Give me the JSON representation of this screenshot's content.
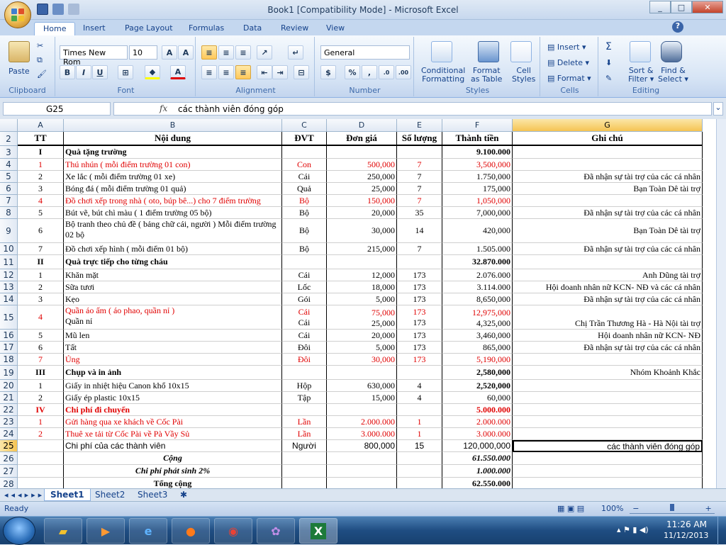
{
  "window": {
    "title": "Book1  [Compatibility Mode] - Microsoft Excel"
  },
  "tabs": [
    "Home",
    "Insert",
    "Page Layout",
    "Formulas",
    "Data",
    "Review",
    "View"
  ],
  "ribbon": {
    "clipboard": {
      "paste": "Paste",
      "label": "Clipboard"
    },
    "font": {
      "name": "Times New Rom",
      "size": "10",
      "label": "Font"
    },
    "alignment": {
      "label": "Alignment"
    },
    "number": {
      "format": "General",
      "label": "Number"
    },
    "styles": {
      "cond": "Conditional",
      "cond2": "Formatting",
      "fmt": "Format",
      "fmt2": "as Table",
      "cell": "Cell",
      "cell2": "Styles",
      "label": "Styles"
    },
    "cells": {
      "insert": "Insert",
      "delete": "Delete",
      "format": "Format",
      "label": "Cells"
    },
    "editing": {
      "sort": "Sort &",
      "sort2": "Filter",
      "find": "Find &",
      "find2": "Select",
      "label": "Editing"
    }
  },
  "formula_bar": {
    "name_box": "G25",
    "fx": "fx",
    "content": "các  thành viên đóng góp"
  },
  "columns": [
    "A",
    "B",
    "C",
    "D",
    "E",
    "F",
    "G"
  ],
  "rows": [
    {
      "n": "2",
      "cells": [
        "TT",
        "Nội dung",
        "ĐVT",
        "Đơn giá",
        "Số lượng",
        "Thành tiền",
        "Ghi chú"
      ]
    },
    {
      "n": "3",
      "cells": [
        "I",
        "Quà tặng trường",
        "",
        "",
        "",
        "9.100.000",
        ""
      ]
    },
    {
      "n": "4",
      "cells": [
        "1",
        "Thú nhún ( mỗi điểm trường 01 con)",
        "Con",
        "500,000",
        "7",
        "3,500,000",
        ""
      ]
    },
    {
      "n": "5",
      "cells": [
        "2",
        "Xe lắc ( mỗi điểm trường 01 xe)",
        "Cái",
        "250,000",
        "7",
        "1.750,000",
        "Đã nhận sự tài  trợ của các cá nhân"
      ]
    },
    {
      "n": "6",
      "cells": [
        "3",
        "Bóng đá ( mỗi điểm trường 01 quả)",
        "Quả",
        "25,000",
        "7",
        "175,000",
        "Bạn Toàn Dê tài trợ"
      ]
    },
    {
      "n": "7",
      "cells": [
        "4",
        "Đồ chơi xếp trong nhà ( oto, búp bê...) cho 7 điểm trường",
        "Bộ",
        "150,000",
        "7",
        "1,050,000",
        ""
      ]
    },
    {
      "n": "8",
      "cells": [
        "5",
        "Bút vẽ, bút chì màu ( 1 điểm trường 05 bộ)",
        "Bộ",
        "20,000",
        "35",
        "7,000,000",
        "Đã nhận sự tài  trợ của các cá nhân"
      ]
    },
    {
      "n": "9",
      "cells": [
        "6",
        "Bộ tranh theo chủ đề ( bảng chữ cái, người ) Mỗi điểm trường 02 bộ",
        "Bộ",
        "30,000",
        "14",
        "420,000",
        "Bạn Toàn Dê tài trợ"
      ]
    },
    {
      "n": "10",
      "cells": [
        "7",
        "Đồ chơi xếp hình ( mỗi điểm 01 bộ)",
        "Bộ",
        "215,000",
        "7",
        "1.505.000",
        "Đã nhận sự tài  trợ của các cá nhân"
      ]
    },
    {
      "n": "11",
      "cells": [
        "II",
        "Quà trực tiếp cho từng cháu",
        "",
        "",
        "",
        "32.870.000",
        ""
      ]
    },
    {
      "n": "12",
      "cells": [
        "1",
        "Khăn mặt",
        "Cái",
        "12,000",
        "173",
        "2.076.000",
        "Anh Dũng tài trợ"
      ]
    },
    {
      "n": "13",
      "cells": [
        "2",
        "Sữa tươi",
        "Lốc",
        "18,000",
        "173",
        "3.114.000",
        "Hội doanh nhân nữ KCN- NĐ và các cá nhân"
      ]
    },
    {
      "n": "14",
      "cells": [
        "3",
        "Kẹo",
        "Gói",
        "5,000",
        "173",
        "8,650,000",
        "Đã nhận sự tài  trợ của các cá nhân"
      ]
    },
    {
      "n": "15",
      "cells": [
        "4",
        "Quần áo ấm ( áo phao, quần nỉ )",
        "Cái",
        "75,000",
        "173",
        "12,975,000",
        ""
      ],
      "sub": [
        "",
        "Quần nỉ",
        "Cái",
        "25,000",
        "173",
        "4,325,000",
        "Chị Trần Thương Hà - Hà Nội tài trợ"
      ]
    },
    {
      "n": "16",
      "cells": [
        "5",
        "Mũ len",
        "Cái",
        "20,000",
        "173",
        "3,460,000",
        "Hội doanh nhân nữ KCN- NĐ"
      ]
    },
    {
      "n": "17",
      "cells": [
        "6",
        "Tất",
        "Đôi",
        "5,000",
        "173",
        "865,000",
        "Đã nhận sự tài  trợ của các cá nhân"
      ]
    },
    {
      "n": "18",
      "cells": [
        "7",
        "Ủng",
        "Đôi",
        "30,000",
        "173",
        "5,190,000",
        ""
      ]
    },
    {
      "n": "19",
      "cells": [
        "III",
        "Chụp và in ảnh",
        "",
        "",
        "",
        "2,580,000",
        "Nhóm Khoảnh Khắc"
      ]
    },
    {
      "n": "20",
      "cells": [
        "1",
        "Giấy in nhiệt hiệu Canon khổ 10x15",
        "Hộp",
        "630,000",
        "4",
        "2,520,000",
        ""
      ]
    },
    {
      "n": "21",
      "cells": [
        "2",
        "Giấy ép plastic 10x15",
        "Tập",
        "15,000",
        "4",
        "60,000",
        ""
      ]
    },
    {
      "n": "22",
      "cells": [
        "IV",
        "Chi phí đi chuyển",
        "",
        "",
        "",
        "5.000.000",
        ""
      ]
    },
    {
      "n": "23",
      "cells": [
        "1",
        "Gửi hàng qua xe khách về Cốc Pài",
        "Lần",
        "2.000.000",
        "1",
        "2.000.000",
        ""
      ]
    },
    {
      "n": "24",
      "cells": [
        "2",
        "Thuê xe tải từ Cốc Pài về Pà Vầy Sủ",
        "Lần",
        "3.000.000",
        "1",
        "3.000.000",
        ""
      ]
    },
    {
      "n": "25",
      "cells": [
        "",
        "Chi phí của các thành viên",
        "Người",
        "800,000",
        "15",
        "120,000,000",
        "các  thành viên đóng góp"
      ]
    },
    {
      "n": "26",
      "cells": [
        "",
        "Cộng",
        "",
        "",
        "",
        "61.550.000",
        ""
      ]
    },
    {
      "n": "27",
      "cells": [
        "",
        "Chi phí phát sinh 2%",
        "",
        "",
        "",
        "1.000.000",
        ""
      ]
    },
    {
      "n": "28",
      "cells": [
        "",
        "Tổng cộng",
        "",
        "",
        "",
        "62.550.000",
        ""
      ]
    }
  ],
  "sheet_tabs": [
    "Sheet1",
    "Sheet2",
    "Sheet3"
  ],
  "status": {
    "text": "Ready",
    "zoom": "100%"
  },
  "taskbar": {
    "time": "11:26 AM",
    "date": "11/12/2013"
  }
}
